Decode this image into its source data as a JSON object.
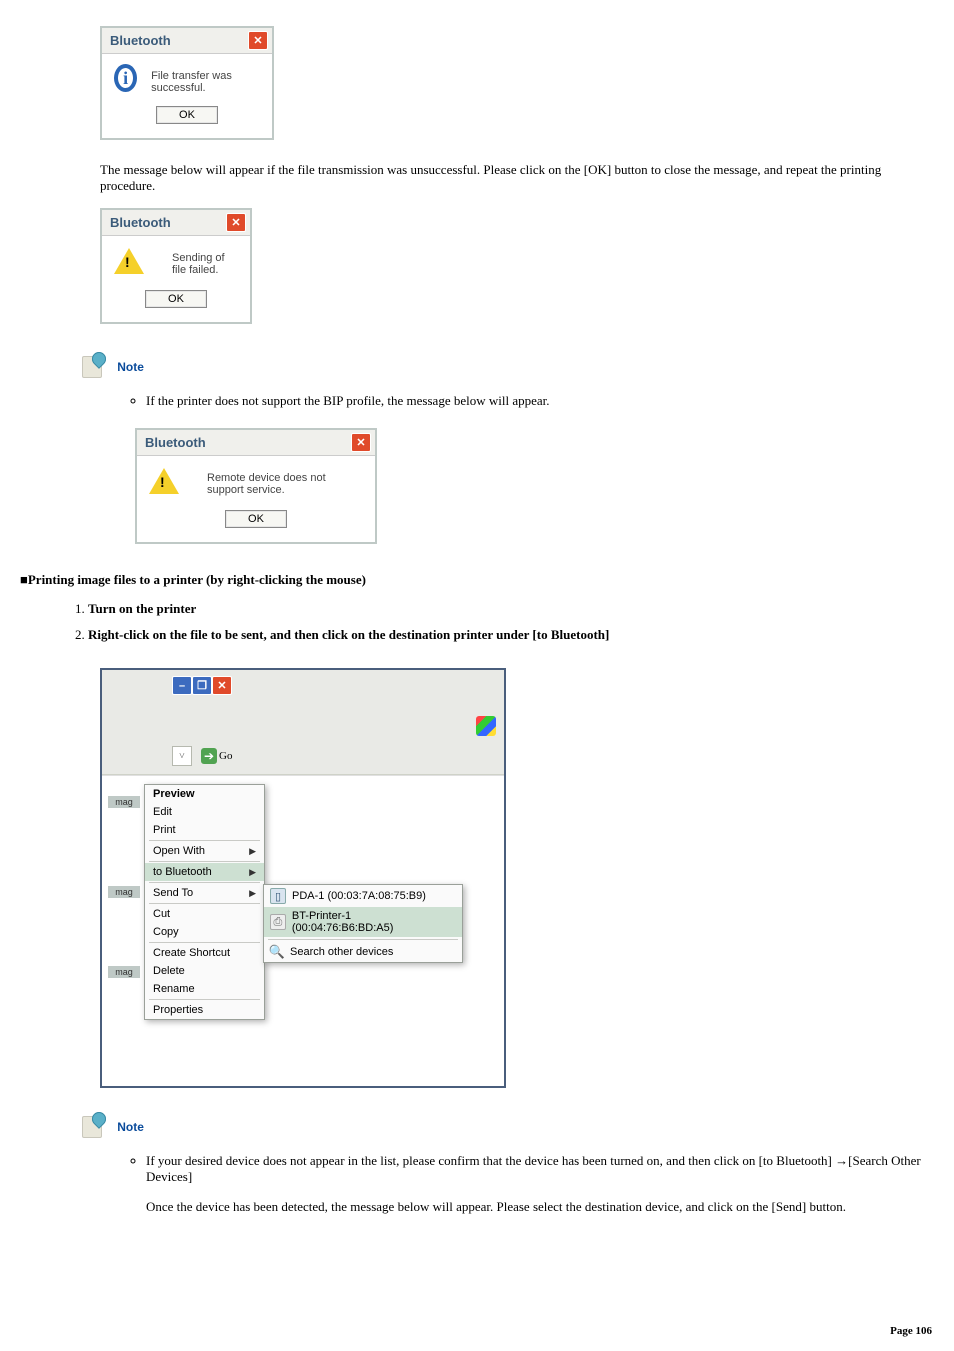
{
  "dialog1": {
    "title": "Bluetooth",
    "msg": "File transfer was successful.",
    "ok": "OK"
  },
  "para1": "The message below will appear if the file transmission was unsuccessful. Please click on the [OK] button to close the message, and repeat the printing procedure.",
  "dialog2": {
    "title": "Bluetooth",
    "msg": "Sending of file failed.",
    "ok": "OK"
  },
  "note1": {
    "label": "Note",
    "bullet": "If the printer does not support the BIP profile, the message below will appear."
  },
  "dialog3": {
    "title": "Bluetooth",
    "msg": "Remote device does not support service.",
    "ok": "OK"
  },
  "heading": "■Printing image files to a printer (by right-clicking the mouse)",
  "steps": [
    "Turn on the printer",
    "Right-click on the file to be sent, and then click on the destination printer under [to Bluetooth]"
  ],
  "explorer": {
    "go": "Go",
    "thumb_label": "mag",
    "context_menu": [
      {
        "label": "Preview",
        "bold": true
      },
      {
        "label": "Edit"
      },
      {
        "label": "Print"
      },
      {
        "sep": true
      },
      {
        "label": "Open With",
        "arrow": true
      },
      {
        "sep": true
      },
      {
        "label": "to Bluetooth",
        "arrow": true,
        "highlight": true
      },
      {
        "sep": true
      },
      {
        "label": "Send To",
        "arrow": true
      },
      {
        "sep": true
      },
      {
        "label": "Cut"
      },
      {
        "label": "Copy"
      },
      {
        "sep": true
      },
      {
        "label": "Create Shortcut"
      },
      {
        "label": "Delete"
      },
      {
        "label": "Rename"
      },
      {
        "sep": true
      },
      {
        "label": "Properties"
      }
    ],
    "submenu": [
      {
        "icon": "pda",
        "label": "PDA-1 (00:03:7A:08:75:B9)"
      },
      {
        "icon": "printer",
        "label": "BT-Printer-1 (00:04:76:B6:BD:A5)",
        "highlight": true
      },
      {
        "sep": true
      },
      {
        "icon": "search",
        "label": "Search other devices"
      }
    ]
  },
  "note2": {
    "label": "Note",
    "bullet": "If your desired device does not appear in the list, please confirm that the device has been turned on, and then click on [to Bluetooth] →[Search Other Devices]",
    "para": "Once the device has been detected, the message below will appear. Please select the destination device, and click on the [Send] button."
  },
  "page_number": "Page 106"
}
